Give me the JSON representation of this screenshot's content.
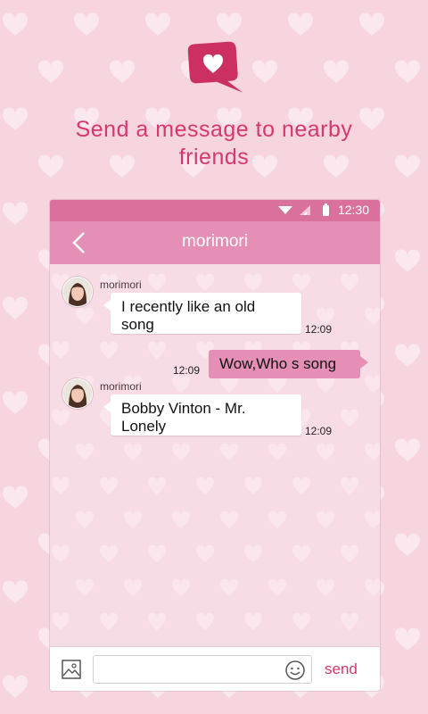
{
  "headline": {
    "line1": "Send a message to nearby",
    "line2": "friends"
  },
  "status_bar": {
    "time": "12:30",
    "icons": [
      "wifi-icon",
      "signal-icon",
      "battery-icon"
    ]
  },
  "chat_header": {
    "title": "morimori",
    "back_icon": "back-arrow-icon"
  },
  "messages": [
    {
      "direction": "incoming",
      "sender": "morimori",
      "line1": "I recently like an old",
      "line2": "song",
      "time": "12:09"
    },
    {
      "direction": "outgoing",
      "text": "Wow,Who s song",
      "time": "12:09"
    },
    {
      "direction": "incoming",
      "sender": "morimori",
      "line1": "Bobby Vinton - Mr.",
      "line2": "Lonely",
      "time": "12:09"
    }
  ],
  "composer": {
    "input_value": "",
    "send_label": "send",
    "attach_icon": "image-icon",
    "emoji_icon": "smiley-icon"
  },
  "colors": {
    "background": "#f6d5df",
    "accent": "#d4386d",
    "header": "#e58fb6",
    "status_bar": "#d9719c",
    "outgoing_bubble": "#e58fb6"
  }
}
